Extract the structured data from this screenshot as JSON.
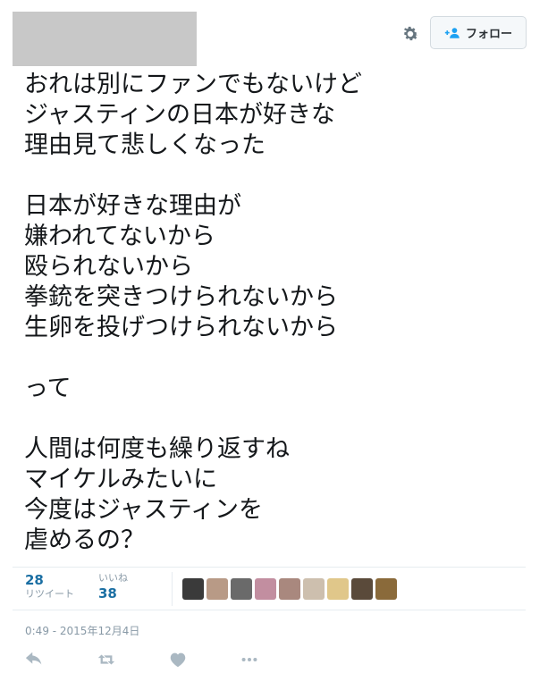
{
  "header": {
    "follow_label": "フォロー",
    "gear_icon": "gear-icon",
    "follow_icon": "follow-user-plus-icon"
  },
  "tweet": {
    "text_lines": [
      "おれは別にファンでもないけど",
      "ジャスティンの日本が好きな",
      "理由見て悲しくなった",
      "",
      "日本が好きな理由が",
      "嫌われてないから",
      "殴られないから",
      "拳銃を突きつけられないから",
      "生卵を投げつけられないから",
      "",
      "って",
      "",
      "人間は何度も繰り返すね",
      "マイケルみたいに",
      "今度はジャスティンを",
      "虐めるの？"
    ]
  },
  "stats": {
    "retweets_count": "28",
    "retweets_label": "リツイート",
    "likes_label": "いいね",
    "likes_count": "38"
  },
  "avatars": [
    {
      "color": "#3a3a3a"
    },
    {
      "color": "#b89a86"
    },
    {
      "color": "#6a6a6a"
    },
    {
      "color": "#c28ea0"
    },
    {
      "color": "#a9887e"
    },
    {
      "color": "#cdbfae"
    },
    {
      "color": "#e0c78a"
    },
    {
      "color": "#5a4a3a"
    },
    {
      "color": "#8a6a3a"
    }
  ],
  "timestamp": "0:49 - 2015年12月4日",
  "actions": [
    "reply-icon",
    "retweet-icon",
    "like-heart-icon",
    "more-dots-icon"
  ],
  "colors": {
    "link_blue": "#1b6fa3",
    "muted": "#8899a6",
    "border": "#e6ecf0"
  }
}
